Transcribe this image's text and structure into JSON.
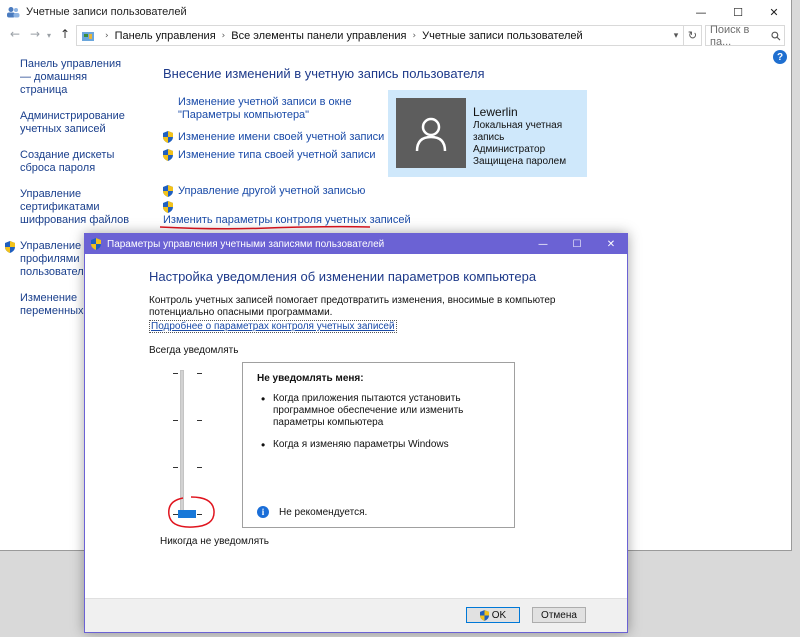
{
  "window": {
    "title": "Учетные записи пользователей",
    "minimize_glyph": "—",
    "maximize_glyph": "☐",
    "close_glyph": "✕"
  },
  "address_bar": {
    "crumbs": [
      "Панель управления",
      "Все элементы панели управления",
      "Учетные записи пользователей"
    ],
    "search_placeholder": "Поиск в па..."
  },
  "sidebar": {
    "items": [
      {
        "label": "Панель управления — домашняя страница"
      },
      {
        "label": "Администрирование учетных записей"
      },
      {
        "label": "Создание дискеты сброса пароля"
      },
      {
        "label": "Управление сертификатами шифрования файлов"
      },
      {
        "label": "Управление профилями пользователей"
      },
      {
        "label": "Изменение переменных среды"
      }
    ]
  },
  "main": {
    "title": "Внесение изменений в учетную запись пользователя",
    "links": {
      "pc_settings": "Изменение учетной записи в окне \"Параметры компьютера\"",
      "rename": "Изменение имени своей учетной записи",
      "change_type": "Изменение типа своей учетной записи",
      "manage_other": "Управление другой учетной записью",
      "uac_settings": "Изменить параметры контроля учетных записей"
    }
  },
  "user_card": {
    "name": "Lewerlin",
    "lines": [
      "Локальная учетная запись",
      "Администратор",
      "Защищена паролем"
    ]
  },
  "uac_dialog": {
    "title": "Параметры управления учетными записями пользователей",
    "heading": "Настройка уведомления об изменении параметров компьютера",
    "description": "Контроль учетных записей помогает предотвратить изменения, вносимые в компьютер потенциально опасными программами.",
    "more_link": "Подробнее о параметрах контроля учетных записей",
    "slider_top_label": "Всегда уведомлять",
    "slider_bottom_label": "Никогда не уведомлять",
    "slider_level": 0,
    "slider_levels": 4,
    "info": {
      "title": "Не уведомлять меня:",
      "bullets": [
        "Когда приложения пытаются установить программное обеспечение или изменить параметры компьютера",
        "Когда я изменяю параметры Windows"
      ],
      "footer": "Не рекомендуется."
    },
    "ok_label": "OK",
    "cancel_label": "Отмена"
  },
  "colors": {
    "accent": "#6b62d4",
    "link": "#1a4ba8",
    "heading": "#1e3a8a",
    "slider_thumb": "#1878d8",
    "annotation": "#e0141e"
  }
}
